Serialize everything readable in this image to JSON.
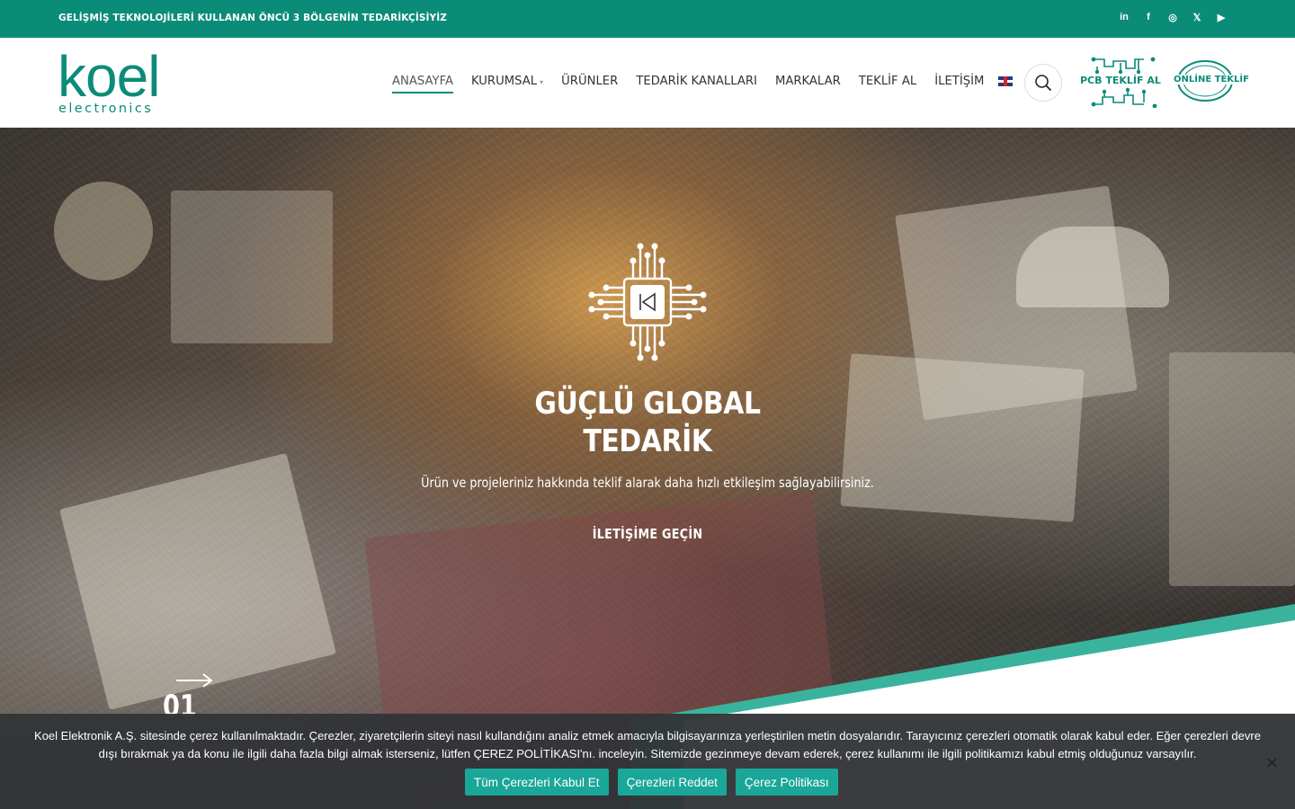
{
  "topbar": {
    "tagline": "GELİŞMİŞ TEKNOLOJİLERİ KULLANAN ÖNCÜ 3 BÖLGENİN TEDARİKÇİSİYİZ",
    "social": [
      {
        "icon": "linkedin-icon",
        "glyph": "in"
      },
      {
        "icon": "facebook-icon",
        "glyph": "f"
      },
      {
        "icon": "instagram-icon",
        "glyph": "◎"
      },
      {
        "icon": "x-twitter-icon",
        "glyph": "𝕏"
      },
      {
        "icon": "youtube-icon",
        "glyph": "▶"
      }
    ]
  },
  "header": {
    "logo_word": "koel",
    "logo_sub": "electronics",
    "nav": [
      {
        "label": "ANASAYFA",
        "active": true
      },
      {
        "label": "KURUMSAL",
        "dropdown": true
      },
      {
        "label": "ÜRÜNLER"
      },
      {
        "label": "TEDARİK KANALLARI"
      },
      {
        "label": "MARKALAR"
      },
      {
        "label": "TEKLİF AL"
      },
      {
        "label": "İLETİŞİM"
      }
    ],
    "language_flag": "uk-flag-icon",
    "pcb_badge": "PCB TEKLİF AL",
    "online_badge": "ONLİNE TEKLİF"
  },
  "hero": {
    "title_line1": "GÜÇLÜ GLOBAL",
    "title_line2": "TEDARİK",
    "subtitle": "Ürün ve projeleriniz hakkında teklif alarak daha hızlı etkileşim sağlayabilirsiniz.",
    "cta": "İLETİŞİME GEÇİN",
    "slide_number": "01"
  },
  "cookie": {
    "text": "Koel Elektronik A.Ş. sitesinde çerez kullanılmaktadır. Çerezler, ziyaretçilerin siteyi nasıl kullandığını analiz etmek amacıyla bilgisayarınıza yerleştirilen metin dosyalarıdır. Tarayıcınız çerezleri otomatik olarak kabul eder. Eğer çerezleri devre dışı bırakmak ya da konu ile ilgili daha fazla bilgi almak isterseniz, lütfen ÇEREZ POLİTİKASI'nı. inceleyin. Sitemizde gezinmeye devam ederek, çerez kullanımı ile ilgili politikamızı kabul etmiş olduğunuz varsayılır.",
    "accept": "Tüm Çerezleri Kabul Et",
    "reject": "Çerezleri Reddet",
    "policy": "Çerez Politikası",
    "close": "×"
  },
  "colors": {
    "brand": "#0b8c79",
    "accent_diagonal": "#3ab39e",
    "cookie_bg": "#323437",
    "cookie_button": "#1aa699"
  }
}
